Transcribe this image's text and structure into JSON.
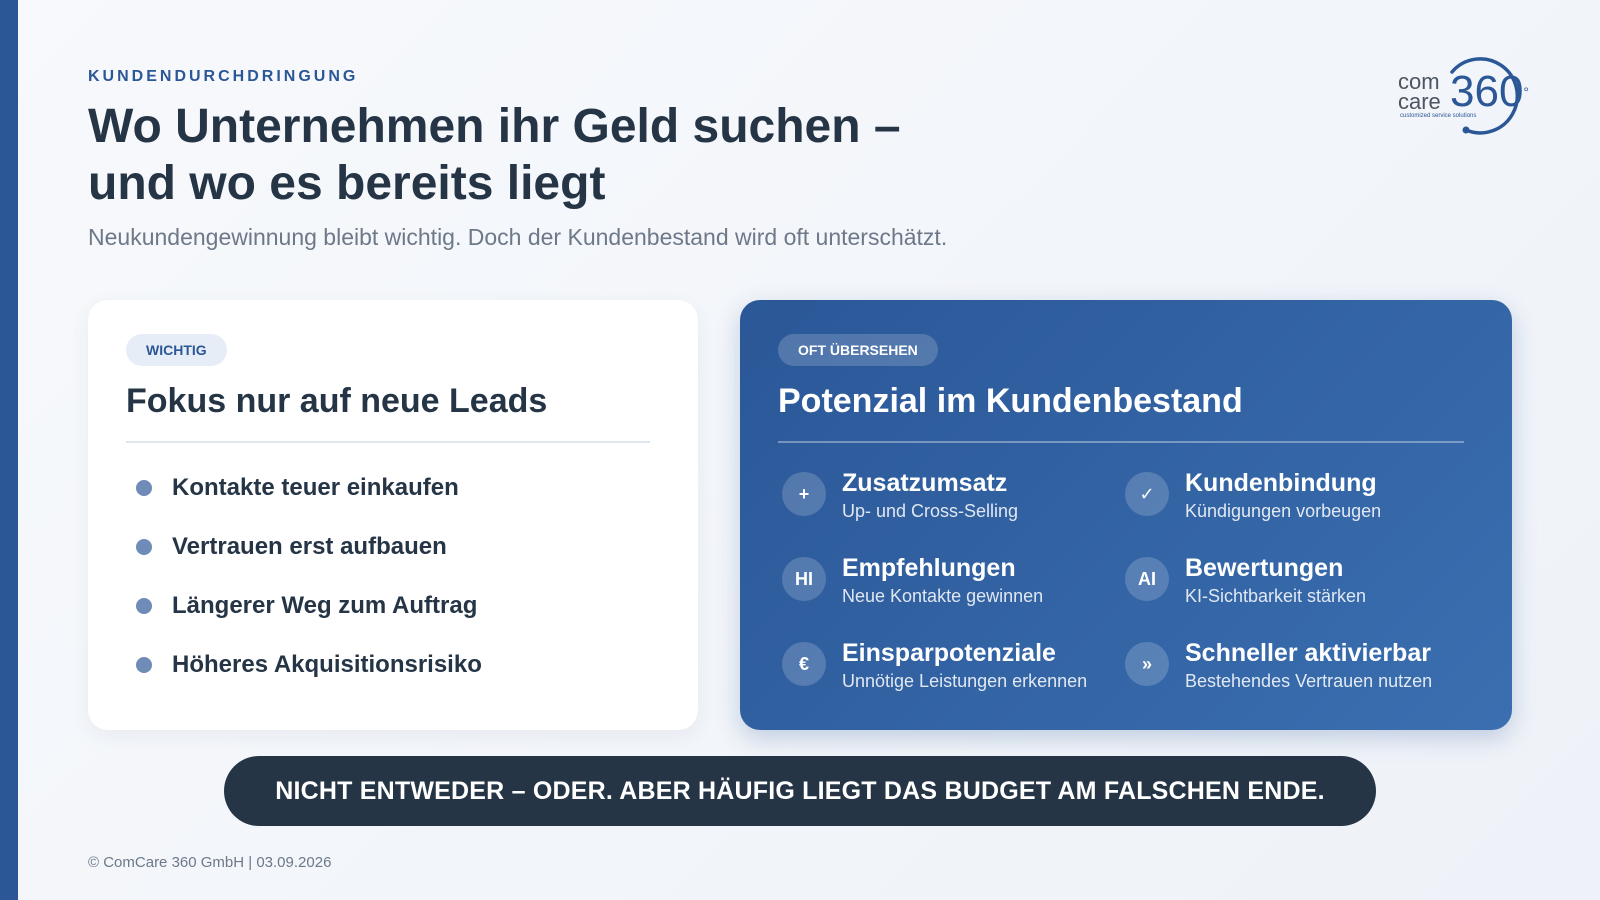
{
  "header": {
    "eyebrow": "KUNDENDURCHDRINGUNG",
    "title_line1": "Wo Unternehmen ihr Geld suchen –",
    "title_line2": "und wo es bereits liegt",
    "subtitle": "Neukundengewinnung bleibt wichtig. Doch der Kundenbestand wird oft unterschätzt."
  },
  "logo": {
    "com": "com",
    "care": "care",
    "number": "360",
    "degree": "°",
    "tagline": "customized service solutions"
  },
  "left_card": {
    "badge": "WICHTIG",
    "heading": "Fokus nur auf neue Leads",
    "items": [
      "Kontakte teuer einkaufen",
      "Vertrauen erst aufbauen",
      "Längerer Weg zum Auftrag",
      "Höheres Akquisitionsrisiko"
    ]
  },
  "right_card": {
    "badge": "OFT ÜBERSEHEN",
    "heading": "Potenzial im Kundenbestand",
    "features": [
      {
        "icon": "+",
        "icon_name": "plus-icon",
        "title": "Zusatzumsatz",
        "subtitle": "Up- und Cross-Selling"
      },
      {
        "icon": "✓",
        "icon_name": "check-icon",
        "title": "Kundenbindung",
        "subtitle": "Kündigungen vorbeugen"
      },
      {
        "icon": "HI",
        "icon_name": "hi-icon",
        "title": "Empfehlungen",
        "subtitle": "Neue Kontakte gewinnen"
      },
      {
        "icon": "AI",
        "icon_name": "ai-icon",
        "title": "Bewertungen",
        "subtitle": "KI-Sichtbarkeit stärken"
      },
      {
        "icon": "€",
        "icon_name": "euro-icon",
        "title": "Einsparpotenziale",
        "subtitle": "Unnötige Leistungen erkennen"
      },
      {
        "icon": "»",
        "icon_name": "double-chevron-icon",
        "title": "Schneller aktivierbar",
        "subtitle": "Bestehendes Vertrauen nutzen"
      }
    ]
  },
  "banner": {
    "text": "NICHT ENTWEDER – ODER. ABER HÄUFIG LIEGT DAS BUDGET AM FALSCHEN ENDE."
  },
  "footer": {
    "text": "© ComCare 360 GmbH | 03.09.2026"
  },
  "colors": {
    "accent": "#2b5797",
    "dark": "#253546",
    "muted": "#6d7888",
    "bullet": "#6f8bb8"
  }
}
